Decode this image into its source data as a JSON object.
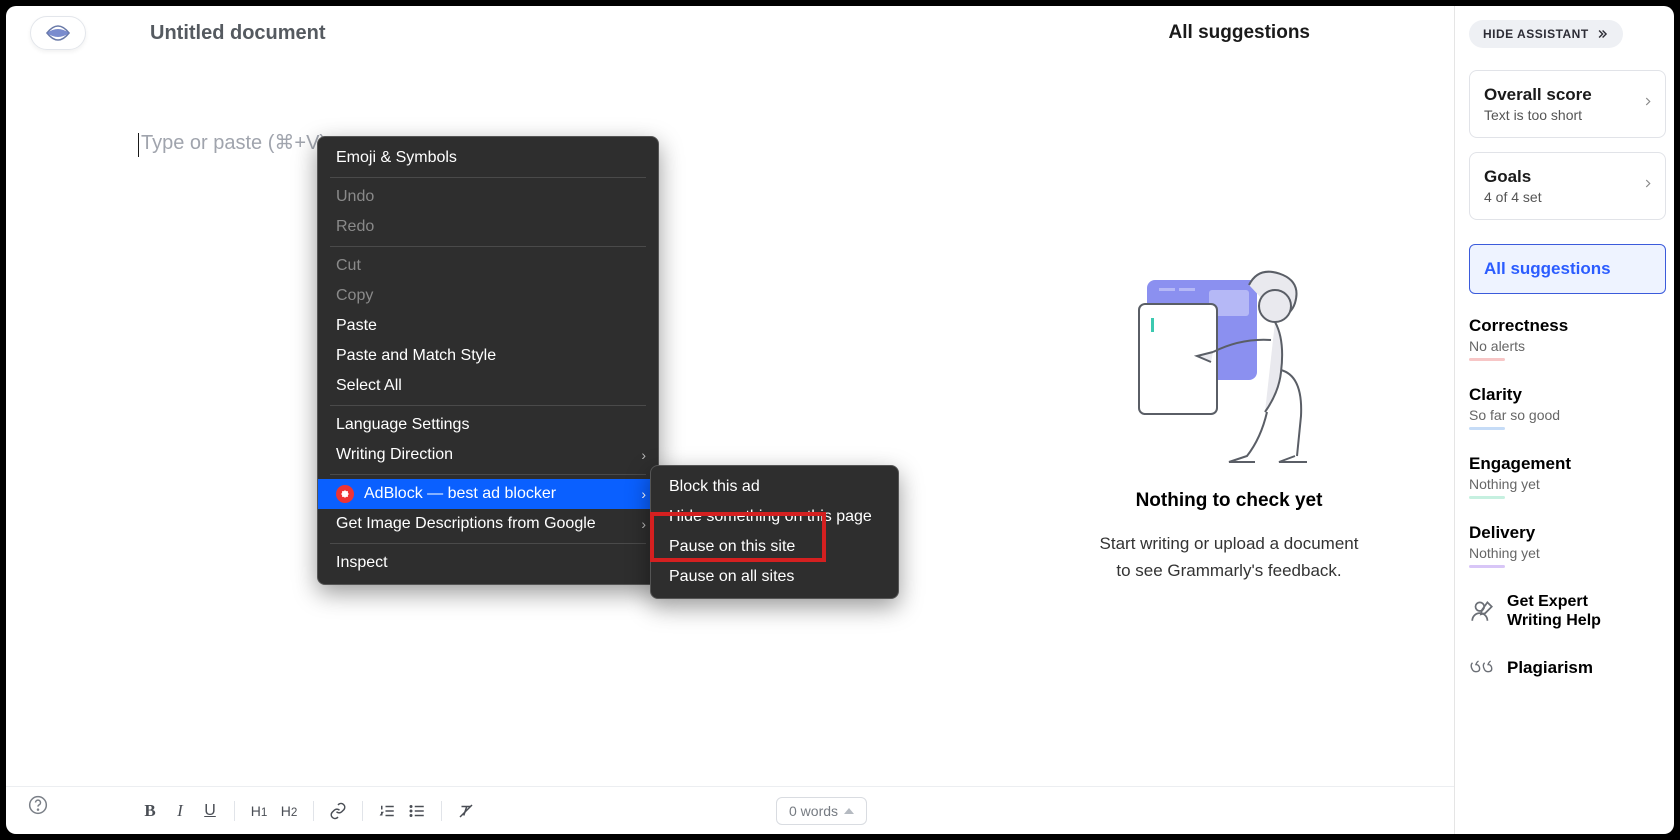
{
  "top": {
    "doc_title": "Untitled document",
    "all_suggestions": "All suggestions"
  },
  "editor": {
    "placeholder": "Type or paste (⌘+V) "
  },
  "suggestions_pane": {
    "nothing_title": "Nothing to check yet",
    "nothing_line1": "Start writing or upload a document",
    "nothing_line2": "to see Grammarly's feedback."
  },
  "bottom": {
    "words": "0 words"
  },
  "sidebar": {
    "hide": "HIDE ASSISTANT",
    "score": {
      "title": "Overall score",
      "sub": "Text is too short"
    },
    "goals": {
      "title": "Goals",
      "sub": "4 of 4 set"
    },
    "active": "All suggestions",
    "cats": {
      "correctness": {
        "title": "Correctness",
        "sub": "No alerts"
      },
      "clarity": {
        "title": "Clarity",
        "sub": "So far so good"
      },
      "engagement": {
        "title": "Engagement",
        "sub": "Nothing yet"
      },
      "delivery": {
        "title": "Delivery",
        "sub": "Nothing yet"
      }
    },
    "expert": {
      "line1": "Get Expert",
      "line2": "Writing Help"
    },
    "plag": "Plagiarism"
  },
  "context_menu": {
    "emoji": "Emoji & Symbols",
    "undo": "Undo",
    "redo": "Redo",
    "cut": "Cut",
    "copy": "Copy",
    "paste": "Paste",
    "paste_match": "Paste and Match Style",
    "select_all": "Select All",
    "lang": "Language Settings",
    "writing_dir": "Writing Direction",
    "adblock": "AdBlock — best ad blocker",
    "img_desc": "Get Image Descriptions from Google",
    "inspect": "Inspect"
  },
  "submenu": {
    "block": "Block this ad",
    "hide": "Hide something on this page",
    "pause_site": "Pause on this site",
    "pause_all": "Pause on all sites"
  }
}
